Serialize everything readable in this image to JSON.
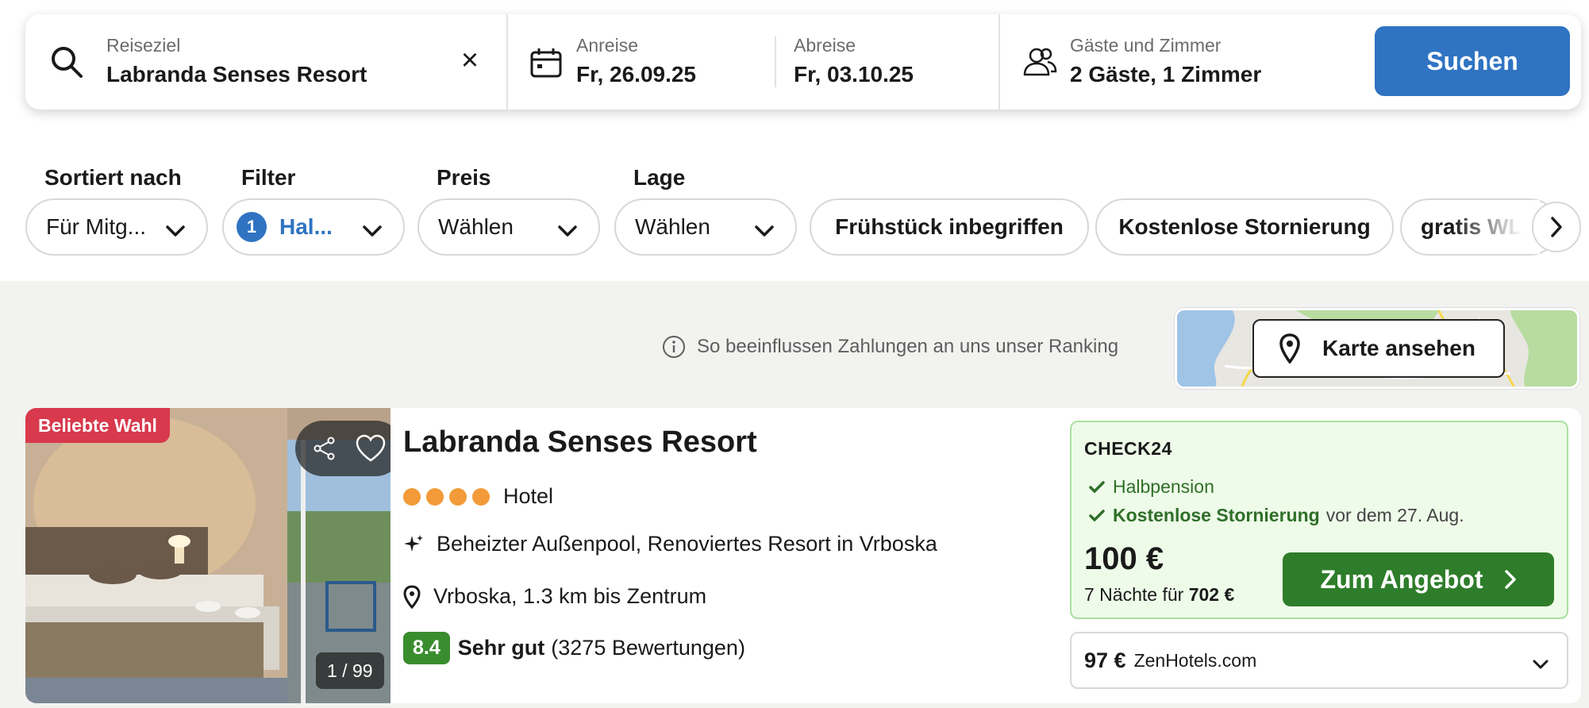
{
  "search": {
    "destination_label": "Reiseziel",
    "destination_value": "Labranda Senses Resort",
    "clear_symbol": "×",
    "checkin_label": "Anreise",
    "checkin_value": "Fr, 26.09.25",
    "checkout_label": "Abreise",
    "checkout_value": "Fr, 03.10.25",
    "guests_label": "Gäste und Zimmer",
    "guests_value": "2 Gäste, 1 Zimmer",
    "submit_label": "Suchen"
  },
  "filters": {
    "sort_label": "Sortiert nach",
    "sort_value": "Für Mitg...",
    "filter_label": "Filter",
    "filter_count": "1",
    "filter_value": "Hal...",
    "price_label": "Preis",
    "price_value": "Wählen",
    "location_label": "Lage",
    "location_value": "Wählen",
    "quick": [
      "Frühstück inbegriffen",
      "Kostenlose Stornierung",
      "gratis WLAN"
    ]
  },
  "ranking_note": "So beeinflussen Zahlungen an uns unser Ranking",
  "map": {
    "button_label": "Karte ansehen"
  },
  "hotel": {
    "badge": "Beliebte Wahl",
    "photo_counter": "1 / 99",
    "name": "Labranda Senses Resort",
    "stars": 4,
    "type": "Hotel",
    "highlight": "Beheizter Außenpool, Renoviertes Resort in Vrboska",
    "location": "Vrboska, 1.3 km bis Zentrum",
    "score": "8.4",
    "rating_label": "Sehr gut",
    "reviews": "(3275 Bewertungen)"
  },
  "offer": {
    "provider": "CHECK24",
    "perk1": "Halbpension",
    "perk2_strong": "Kostenlose Stornierung",
    "perk2_rest": "vor dem 27. Aug.",
    "price": "100 €",
    "nights_text": "7 Nächte für",
    "total": "702 €",
    "cta": "Zum Angebot"
  },
  "alt_offer": {
    "price": "97 €",
    "provider": "ZenHotels.com"
  },
  "colors": {
    "brand_blue": "#2f73c2",
    "green": "#2e7d2a",
    "badge_red": "#d8394d",
    "star_orange": "#f29b38"
  }
}
